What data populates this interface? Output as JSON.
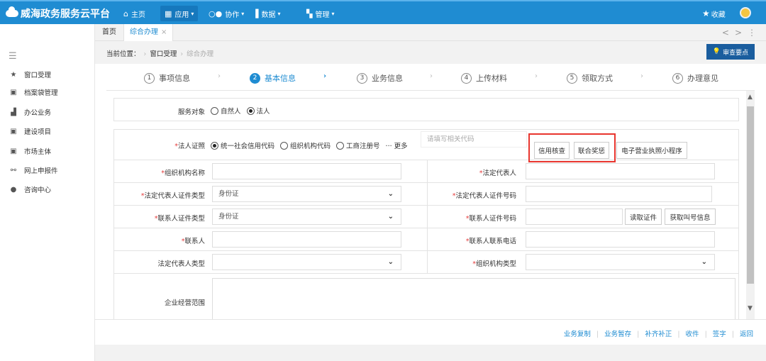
{
  "app": {
    "title": "威海政务服务云平台"
  },
  "nav": {
    "home": "主页",
    "apps": "应用",
    "collab": "协作",
    "data": "数据",
    "manage": "管理",
    "favorites": "收藏"
  },
  "tabs": {
    "home": "首页",
    "current": "综合办理",
    "close": "×",
    "prev": "<",
    "next": ">",
    "more": "⋮"
  },
  "sidebar": {
    "menu_icon": "menu-icon",
    "items": [
      {
        "label": "窗口受理",
        "icon": "star-icon"
      },
      {
        "label": "档案袋管理",
        "icon": "archive-icon"
      },
      {
        "label": "办公业务",
        "icon": "office-icon"
      },
      {
        "label": "建设项目",
        "icon": "building-icon"
      },
      {
        "label": "市场主体",
        "icon": "market-icon"
      },
      {
        "label": "网上申报件",
        "icon": "network-icon"
      },
      {
        "label": "咨询中心",
        "icon": "location-icon"
      }
    ]
  },
  "breadcrumb": {
    "prefix": "当前位置：",
    "level1": "窗口受理",
    "level2": "综合办理"
  },
  "hint_button": "审查要点",
  "steps": [
    {
      "num": "1",
      "label": "事项信息"
    },
    {
      "num": "2",
      "label": "基本信息"
    },
    {
      "num": "3",
      "label": "业务信息"
    },
    {
      "num": "4",
      "label": "上传材料"
    },
    {
      "num": "5",
      "label": "领取方式"
    },
    {
      "num": "6",
      "label": "办理意见"
    }
  ],
  "form": {
    "service_target": {
      "label": "服务对象",
      "options": [
        "自然人",
        "法人"
      ],
      "selected": "法人"
    },
    "legal_cert": {
      "label": "法人证照",
      "options": [
        "统一社会信用代码",
        "组织机构代码",
        "工商注册号"
      ],
      "selected": "统一社会信用代码",
      "more": "··· 更多",
      "placeholder": "请填写相关代码",
      "btn_credit": "信用核查",
      "btn_joint": "联合奖惩",
      "btn_ebiz": "电子营业执照小程序"
    },
    "org_name": {
      "label": "组织机构名称",
      "value": ""
    },
    "legal_rep": {
      "label": "法定代表人",
      "value": ""
    },
    "legal_rep_id_type": {
      "label": "法定代表人证件类型",
      "value": "身份证"
    },
    "legal_rep_id_no": {
      "label": "法定代表人证件号码",
      "value": ""
    },
    "contact_id_type": {
      "label": "联系人证件类型",
      "value": "身份证"
    },
    "contact_id_no": {
      "label": "联系人证件号码",
      "value": "",
      "btn_read": "读取证件",
      "btn_queue": "获取叫号信息"
    },
    "contact": {
      "label": "联系人",
      "value": ""
    },
    "contact_phone": {
      "label": "联系人联系电话",
      "value": ""
    },
    "legal_rep_type": {
      "label": "法定代表人类型",
      "value": ""
    },
    "org_type": {
      "label": "组织机构类型",
      "value": ""
    },
    "biz_scope": {
      "label": "企业经营范围",
      "value": ""
    }
  },
  "bottom_actions": [
    "业务复制",
    "业务暂存",
    "补齐补正",
    "收件",
    "签字",
    "返回"
  ]
}
